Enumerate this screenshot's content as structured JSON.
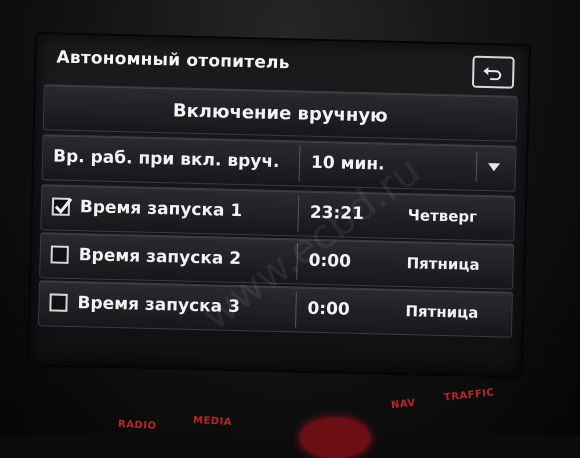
{
  "header": {
    "title": "Автономный отопитель",
    "back_icon": "back-arrow-icon"
  },
  "manual_button": {
    "label": "Включение вручную"
  },
  "runtime_row": {
    "label": "Вр. раб. при вкл. вруч.",
    "value": "10 мин.",
    "dropdown_icon": "triangle-down-icon"
  },
  "start_times": [
    {
      "label": "Время запуска 1",
      "checked": true,
      "time": "23:21",
      "day": "Четверг"
    },
    {
      "label": "Время запуска 2",
      "checked": false,
      "time": "0:00",
      "day": "Пятница"
    },
    {
      "label": "Время запуска 3",
      "checked": false,
      "time": "0:00",
      "day": "Пятница"
    }
  ],
  "hardware_buttons": {
    "radio": "RADIO",
    "media": "MEDIA",
    "nav": "NAV",
    "traffic": "TRAFFIC"
  },
  "watermark": "www.ecbd.ru",
  "colors": {
    "hardware_label": "#b8262a",
    "background": "#0b0b0c",
    "screen": "#16171a"
  }
}
